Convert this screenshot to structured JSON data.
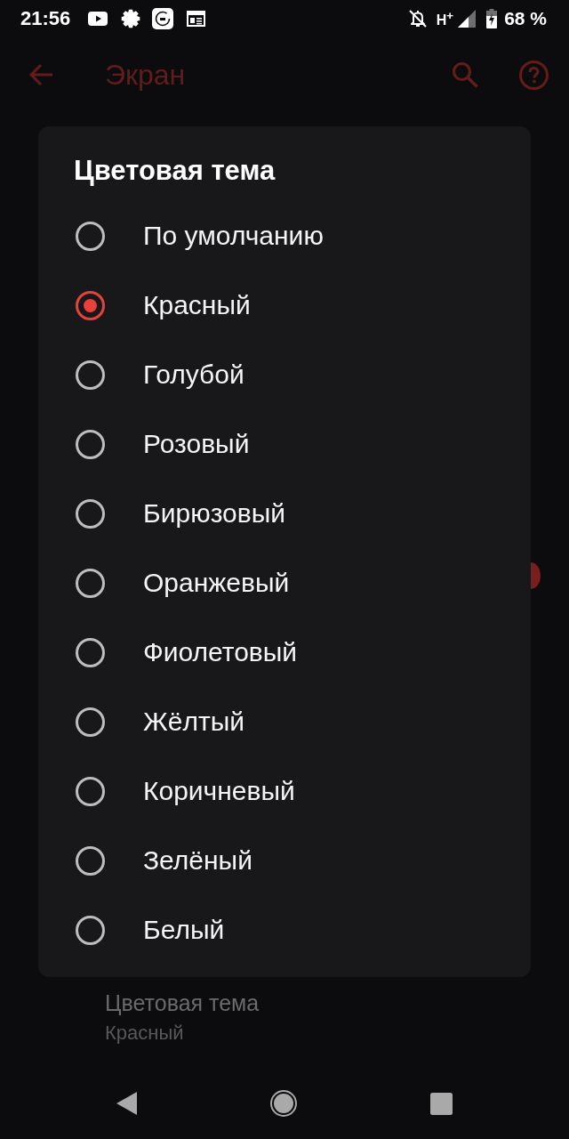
{
  "status_bar": {
    "time": "21:56",
    "network": "H$^{+}$",
    "battery": "68 %"
  },
  "app_bar": {
    "title": "Экран"
  },
  "background": {
    "switch": {
      "on": true
    },
    "setting": {
      "title": "Цветовая тема",
      "value": "Красный"
    }
  },
  "dialog": {
    "title": "Цветовая тема",
    "options": [
      {
        "label": "По умолчанию",
        "selected": false
      },
      {
        "label": "Красный",
        "selected": true
      },
      {
        "label": "Голубой",
        "selected": false
      },
      {
        "label": "Розовый",
        "selected": false
      },
      {
        "label": "Бирюзовый",
        "selected": false
      },
      {
        "label": "Оранжевый",
        "selected": false
      },
      {
        "label": "Фиолетовый",
        "selected": false
      },
      {
        "label": "Жёлтый",
        "selected": false
      },
      {
        "label": "Коричневый",
        "selected": false
      },
      {
        "label": "Зелёный",
        "selected": false
      },
      {
        "label": "Белый",
        "selected": false
      }
    ]
  }
}
